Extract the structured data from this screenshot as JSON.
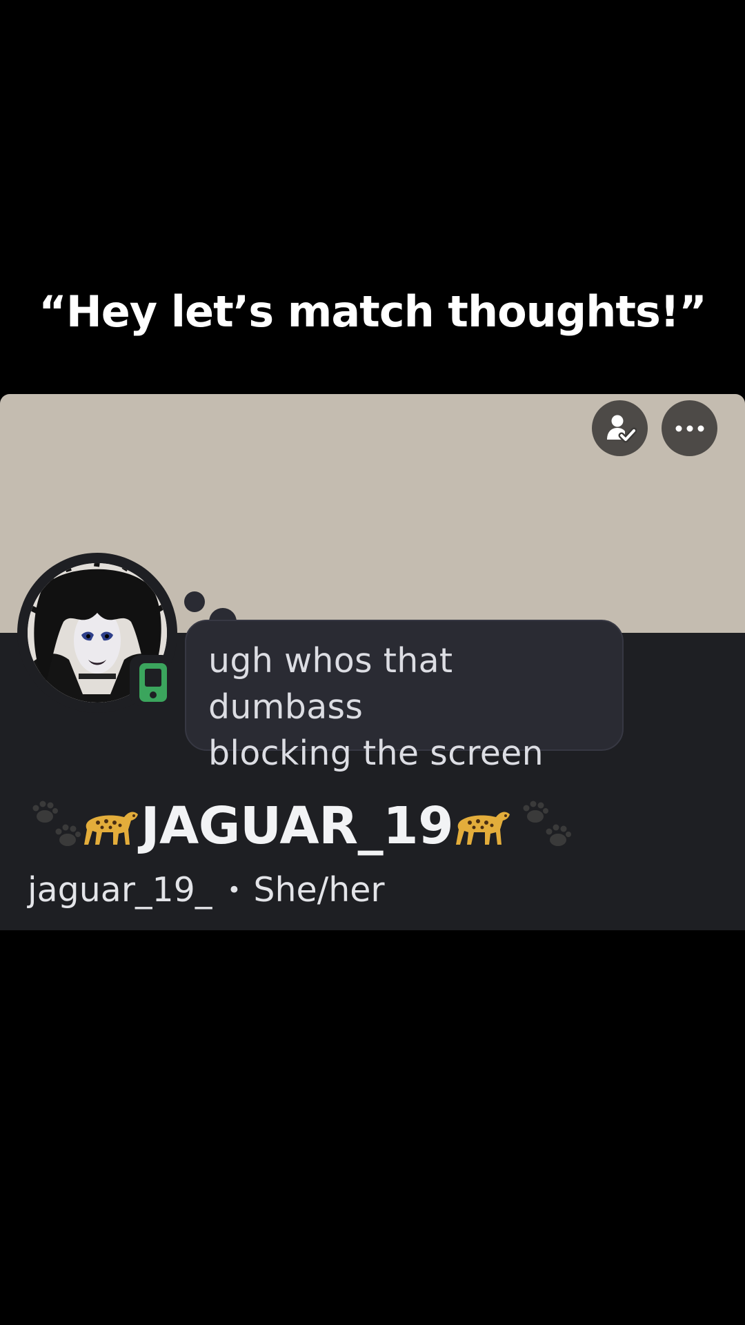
{
  "caption": "“Hey let’s match thoughts!”",
  "profile": {
    "display_name": "JAGUAR_19",
    "username": "jaguar_19_",
    "separator": "•",
    "pronouns": "She/her",
    "status_bubble": {
      "line1": "ugh whos that dumbass",
      "line2": "blocking the screen"
    },
    "status": "mobile-online",
    "banner_color": "#c4bcb0",
    "card_color": "#1e1f23",
    "status_color": "#3ba55d"
  },
  "icons": {
    "friend_button": "friend-added-icon",
    "more_button": "more-options-icon",
    "paws": "paw-prints-icon",
    "leopard": "leopard-icon",
    "status": "mobile-phone-icon"
  }
}
